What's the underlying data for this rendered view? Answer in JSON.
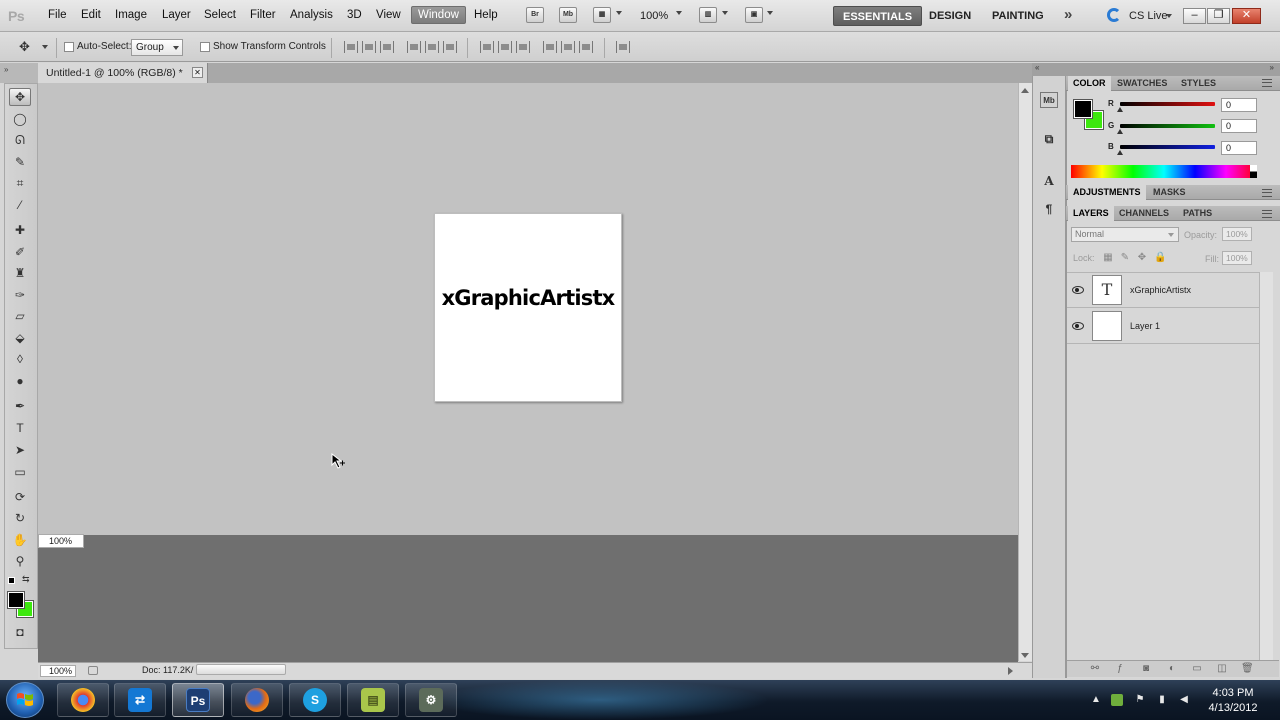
{
  "app": {
    "logo": "Ps",
    "menu": [
      "File",
      "Edit",
      "Image",
      "Layer",
      "Select",
      "Filter",
      "Analysis",
      "3D",
      "View",
      "Window",
      "Help"
    ],
    "active_menu": "Window",
    "toolbar_buttons": [
      "Br",
      "Mb"
    ],
    "zoom": "100%",
    "workspaces": [
      "ESSENTIALS",
      "DESIGN",
      "PAINTING"
    ],
    "active_workspace": "ESSENTIALS",
    "overflow_glyph": "»",
    "cs_live": "CS Live",
    "window_buttons": {
      "minimize": "–",
      "restore": "❐",
      "close": "✕"
    }
  },
  "options_bar": {
    "auto_select_label": "Auto-Select:",
    "auto_select_value": "Group",
    "show_transform_label": "Show Transform Controls"
  },
  "document": {
    "tab_title": "Untitled-1 @ 100% (RGB/8) *",
    "canvas_text": "xGraphicArtistx",
    "zoom_badge": "100%",
    "status_zoom": "100%",
    "status_doc": "Doc: 117.2K/"
  },
  "color_panel": {
    "tabs": [
      "COLOR",
      "SWATCHES",
      "STYLES"
    ],
    "active_tab": "COLOR",
    "foreground": "#000000",
    "background": "#3de80f",
    "channels": [
      {
        "label": "R",
        "value": "0",
        "color": "#e01010"
      },
      {
        "label": "G",
        "value": "0",
        "color": "#10c010"
      },
      {
        "label": "B",
        "value": "0",
        "color": "#1020e0"
      }
    ]
  },
  "adjustments_panel": {
    "tabs": [
      "ADJUSTMENTS",
      "MASKS"
    ],
    "active_tab": "ADJUSTMENTS"
  },
  "layers_panel": {
    "tabs": [
      "LAYERS",
      "CHANNELS",
      "PATHS"
    ],
    "active_tab": "LAYERS",
    "blend_mode": "Normal",
    "opacity_label": "Opacity:",
    "opacity_value": "100%",
    "lock_label": "Lock:",
    "fill_label": "Fill:",
    "fill_value": "100%",
    "layers": [
      {
        "name": "xGraphicArtistx",
        "thumb": "T",
        "visible": true
      },
      {
        "name": "Layer 1",
        "thumb": "",
        "visible": true
      }
    ]
  },
  "taskbar": {
    "items": [
      {
        "name": "chrome",
        "glyph": "●",
        "color": "#e03a2f"
      },
      {
        "name": "teamviewer",
        "glyph": "⇄",
        "color": "#1478d4"
      },
      {
        "name": "photoshop",
        "glyph": "Ps",
        "color": "#1d3e73"
      },
      {
        "name": "firefox",
        "glyph": "●",
        "color": "#e26a16"
      },
      {
        "name": "skype",
        "glyph": "S",
        "color": "#1ea0e0"
      },
      {
        "name": "notes",
        "glyph": "▤",
        "color": "#a9c64b"
      },
      {
        "name": "scanner",
        "glyph": "⚙",
        "color": "#5c6b5a"
      }
    ],
    "clock_time": "4:03 PM",
    "clock_date": "4/13/2012"
  }
}
